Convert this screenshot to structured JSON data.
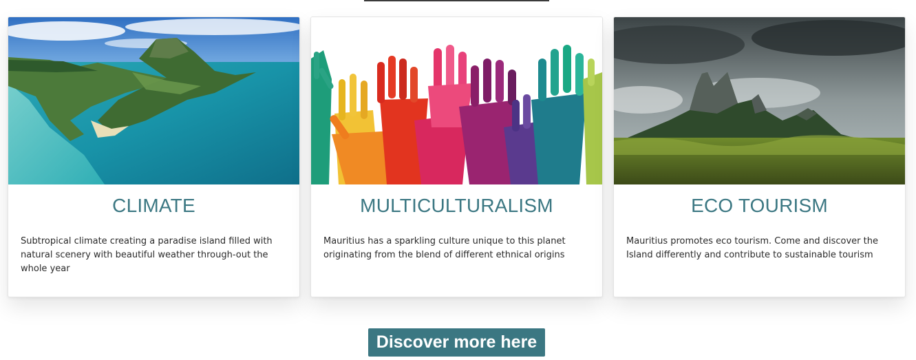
{
  "cards": [
    {
      "title": "CLIMATE",
      "text": "Subtropical climate creating a paradise island filled with natural scenery with beautiful weather through-out the whole year",
      "image": "aerial-island-lagoon-mountain"
    },
    {
      "title": "MULTICULTURALISM",
      "text": "Mauritius has a sparkling culture unique to this planet originating from the blend of different ethnical origins",
      "image": "colorful-raised-hands"
    },
    {
      "title": "ECO TOURISM",
      "text": "Mauritius promotes eco tourism. Come and discover the Island differently and contribute to sustainable tourism",
      "image": "mountain-peaks-grassland-stormy-sky"
    }
  ],
  "cta": {
    "label": "Discover more here"
  },
  "colors": {
    "accent": "#3b7782",
    "text": "#2a2a2a"
  }
}
